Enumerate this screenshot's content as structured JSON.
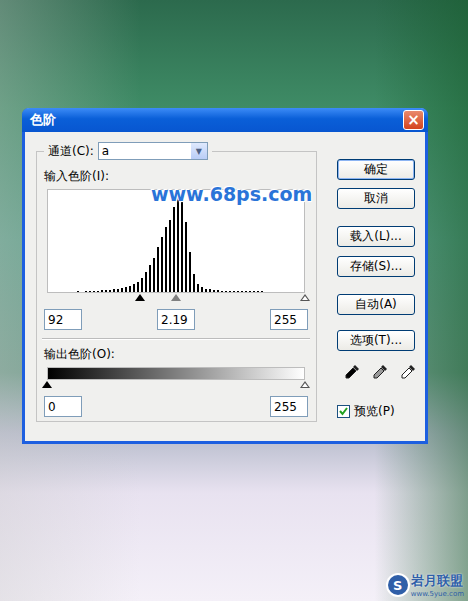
{
  "window": {
    "title": "色阶",
    "close": "×"
  },
  "channel": {
    "label": "通道(C):",
    "value": "a",
    "arrow": "▼"
  },
  "input": {
    "label": "输入色阶(I):",
    "fields": [
      "92",
      "2.19",
      "255"
    ],
    "sliders": [
      {
        "level": 0.36,
        "color": "#000000"
      },
      {
        "level": 0.5,
        "color": "#808080"
      },
      {
        "level": 1,
        "color": "#ffffff"
      }
    ]
  },
  "histogram": [
    0,
    0,
    0,
    0,
    0,
    0,
    0,
    1,
    0,
    1,
    1,
    1,
    1,
    2,
    2,
    2,
    3,
    3,
    4,
    5,
    6,
    8,
    10,
    14,
    20,
    27,
    34,
    45,
    55,
    65,
    72,
    85,
    100,
    98,
    70,
    40,
    18,
    8,
    5,
    3,
    3,
    2,
    2,
    1,
    1,
    1,
    1,
    1,
    1,
    1,
    1,
    1,
    1,
    1,
    0,
    0,
    0,
    0,
    0,
    0,
    0,
    0,
    0,
    0
  ],
  "output": {
    "label": "输出色阶(O):",
    "fields": [
      "0",
      "255"
    ],
    "sliders": [
      {
        "level": 0,
        "color": "#000000"
      },
      {
        "level": 1,
        "color": "#ffffff"
      }
    ]
  },
  "buttons": [
    {
      "label": "确定",
      "default": true
    },
    {
      "label": "取消",
      "default": false
    },
    {
      "label": "载入(L)...",
      "default": false
    },
    {
      "label": "存储(S)...",
      "default": false
    },
    {
      "label": "自动(A)",
      "default": false
    },
    {
      "label": "选项(T)...",
      "default": false
    }
  ],
  "eyedroppers": [
    {
      "color": "#000000"
    },
    {
      "color": "#9a9a9a"
    },
    {
      "color": "#ffffff"
    }
  ],
  "preview": {
    "label": "预览(P)",
    "checked": true
  },
  "watermarks": {
    "site": "www.68ps.com",
    "logo_mark": "S",
    "logo_text": "岩月联盟",
    "logo_url": "www.5yue.com"
  }
}
